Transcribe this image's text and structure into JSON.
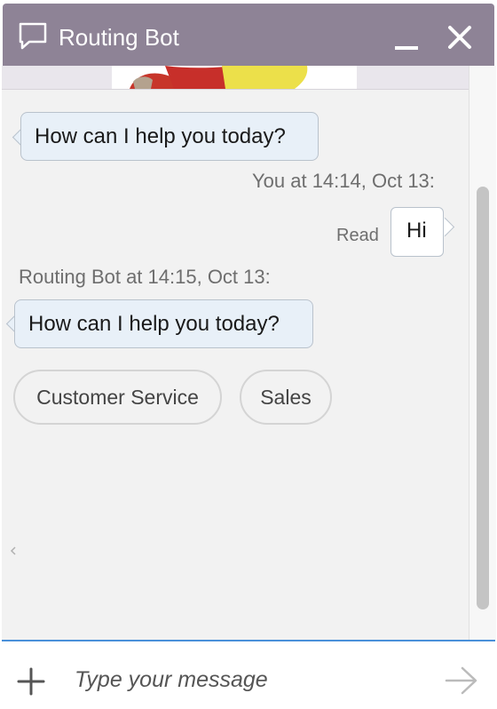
{
  "header": {
    "title": "Routing Bot",
    "icons": {
      "chat": "chat-bubble-icon",
      "minimize": "minimize-icon",
      "close": "close-icon"
    },
    "background_color": "#8e8396"
  },
  "messages": [
    {
      "sender": "bot",
      "text": "How can I help you today?"
    },
    {
      "sender": "user",
      "meta": "You at 14:14, Oct 13:",
      "text": "Hi",
      "status": "Read"
    },
    {
      "sender": "bot",
      "meta": "Routing Bot at 14:15, Oct 13:",
      "text": "How can I help you today?"
    }
  ],
  "quick_replies": [
    "Customer Service",
    "Sales"
  ],
  "composer": {
    "placeholder": "Type your message",
    "icons": {
      "attach": "plus-icon",
      "send": "send-arrow-icon"
    },
    "accent_color": "#4a90d9"
  },
  "colors": {
    "bot_bubble": "#e8f0f8",
    "user_bubble": "#ffffff",
    "chat_background": "#f2f2f2"
  }
}
